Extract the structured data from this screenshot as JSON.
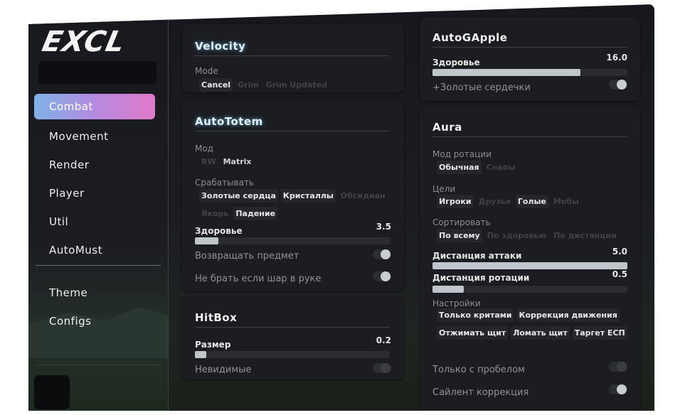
{
  "logo": {
    "text": "EXCL"
  },
  "sidebar": {
    "nav": [
      {
        "label": "Combat",
        "active": true
      },
      {
        "label": "Movement"
      },
      {
        "label": "Render"
      },
      {
        "label": "Player"
      },
      {
        "label": "Util"
      },
      {
        "label": "AutoMust"
      }
    ],
    "bottom": [
      {
        "label": "Theme"
      },
      {
        "label": "Configs"
      }
    ]
  },
  "velocity": {
    "title": "Velocity",
    "mode_label": "Mode",
    "options": [
      {
        "label": "Cancel",
        "selected": true
      },
      {
        "label": "Grim",
        "selected": false
      },
      {
        "label": "Grim Updated",
        "selected": false
      }
    ]
  },
  "autototem": {
    "title": "AutoTotem",
    "mode_label": "Мод",
    "mode_options": [
      {
        "label": "RW",
        "selected": false
      },
      {
        "label": "Matrix",
        "selected": true
      }
    ],
    "trigger_label": "Срабатывать",
    "trigger_options": [
      {
        "label": "Золотые сердца",
        "selected": true
      },
      {
        "label": "Кристаллы",
        "selected": true
      },
      {
        "label": "Обсидиан",
        "selected": false
      },
      {
        "label": "Якорь",
        "selected": false
      },
      {
        "label": "Падение",
        "selected": true
      }
    ],
    "health_label": "Здоровье",
    "health_value": "3.5",
    "health_fraction": 0.12,
    "return_item_label": "Возвращать предмет",
    "return_item_on": true,
    "no_ball_label": "Не брать если шар в руке",
    "no_ball_on": true
  },
  "hitbox": {
    "title": "HitBox",
    "size_label": "Размер",
    "size_value": "0.2",
    "size_fraction": 0.06,
    "invisible_label": "Невидимые",
    "invisible_on": false
  },
  "autogapple": {
    "title": "AutoGApple",
    "health_label": "Здоровье",
    "health_value": "16.0",
    "health_fraction": 0.76,
    "golden_hearts_label": "+Золотые сердечки",
    "golden_hearts_on": true
  },
  "aura": {
    "title": "Aura",
    "rotation_mode_label": "Мод ротации",
    "rotation_options": [
      {
        "label": "Обычная",
        "selected": true
      },
      {
        "label": "Снапы",
        "selected": false
      }
    ],
    "targets_label": "Цели",
    "targets_options": [
      {
        "label": "Игроки",
        "selected": true
      },
      {
        "label": "Друзья",
        "selected": false
      },
      {
        "label": "Голые",
        "selected": true
      },
      {
        "label": "Мобы",
        "selected": false
      }
    ],
    "sort_label": "Сортировать",
    "sort_options": [
      {
        "label": "По всему",
        "selected": true
      },
      {
        "label": "По здоровью",
        "selected": false
      },
      {
        "label": "По дистанции",
        "selected": false
      }
    ],
    "attack_distance_label": "Дистанция аттаки",
    "attack_distance_value": "5.0",
    "attack_distance_fraction": 1.0,
    "rotation_distance_label": "Дистанция ротации",
    "rotation_distance_value": "0.5",
    "rotation_distance_fraction": 0.16,
    "settings_label": "Настройки",
    "settings_options": [
      {
        "label": "Только критами",
        "selected": true
      },
      {
        "label": "Коррекция движения",
        "selected": true
      },
      {
        "label": "Отжимать щит",
        "selected": true
      },
      {
        "label": "Ломать щит",
        "selected": true
      },
      {
        "label": "Таргет ЕСП",
        "selected": true
      }
    ],
    "space_only_label": "Только с пробелом",
    "space_only_on": false,
    "silent_label": "Сайлент коррекция",
    "silent_on": true
  },
  "colors": {
    "accent_start": "#7fb2e6",
    "accent_mid": "#b58ae0",
    "accent_end": "#e07ac8"
  }
}
